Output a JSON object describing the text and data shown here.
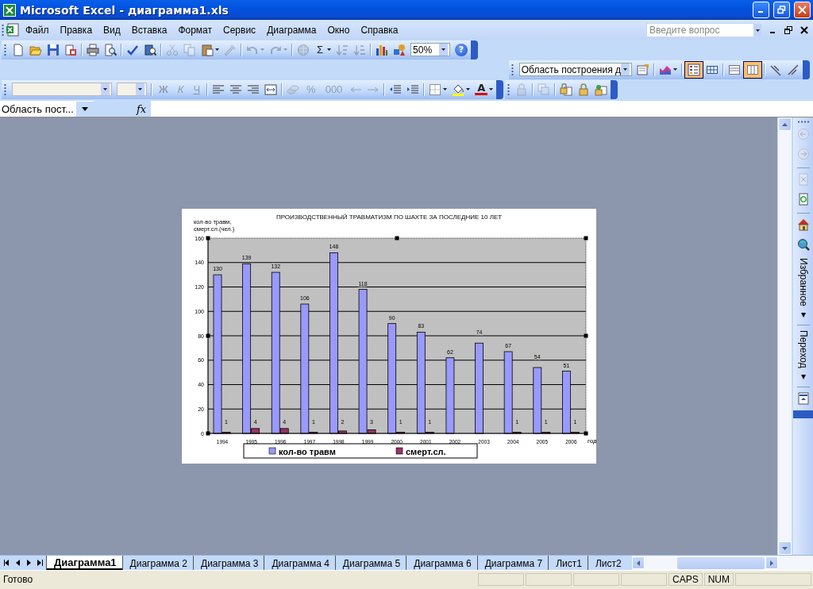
{
  "window": {
    "title": "Microsoft Excel - диаграмма1.xls"
  },
  "menu_bar": {
    "items": [
      "Файл",
      "Правка",
      "Вид",
      "Вставка",
      "Формат",
      "Сервис",
      "Диаграмма",
      "Окно",
      "Справка"
    ],
    "help_search": {
      "placeholder": "Введите вопрос"
    }
  },
  "standard_toolbar": {
    "items": [
      {
        "kind": "icon",
        "disabled": false
      },
      {
        "kind": "icon",
        "disabled": false
      },
      {
        "kind": "icon",
        "disabled": false
      },
      {
        "kind": "icon",
        "disabled": false
      },
      {
        "kind": "separator"
      },
      {
        "kind": "icon",
        "disabled": false
      },
      {
        "kind": "icon",
        "disabled": false
      },
      {
        "kind": "separator"
      },
      {
        "kind": "icon",
        "disabled": false
      },
      {
        "kind": "icon",
        "disabled": false
      },
      {
        "kind": "separator"
      },
      {
        "kind": "icon",
        "disabled": true
      },
      {
        "kind": "icon",
        "disabled": true
      },
      {
        "kind": "icon",
        "disabled": false,
        "dropdown": true
      },
      {
        "kind": "icon",
        "disabled": true
      },
      {
        "kind": "separator"
      },
      {
        "kind": "icon",
        "disabled": true,
        "dropdown": true
      },
      {
        "kind": "icon",
        "disabled": true,
        "dropdown": true
      },
      {
        "kind": "separator"
      },
      {
        "kind": "icon",
        "disabled": true
      },
      {
        "kind": "text",
        "label": "Σ",
        "disabled": false,
        "dropdown": true
      },
      {
        "kind": "icon",
        "disabled": true
      },
      {
        "kind": "icon",
        "disabled": true
      },
      {
        "kind": "separator"
      },
      {
        "kind": "icon",
        "disabled": false
      },
      {
        "kind": "icon",
        "disabled": false
      },
      {
        "kind": "field",
        "value": "50%"
      },
      {
        "kind": "help",
        "label": "?"
      }
    ]
  },
  "chart_toolbar": {
    "items": [
      {
        "kind": "field",
        "value": "Область построения д"
      },
      {
        "kind": "icon",
        "selected": false
      },
      {
        "kind": "separator"
      },
      {
        "kind": "icon",
        "selected": false,
        "dropdown": true
      },
      {
        "kind": "separator"
      },
      {
        "kind": "icon",
        "selected": true
      },
      {
        "kind": "icon",
        "selected": false
      },
      {
        "kind": "separator"
      },
      {
        "kind": "icon",
        "selected": false
      },
      {
        "kind": "icon",
        "selected": true
      },
      {
        "kind": "separator"
      },
      {
        "kind": "icon",
        "selected": false
      },
      {
        "kind": "icon",
        "selected": false
      }
    ]
  },
  "formatting_toolbar": {
    "items": [
      {
        "kind": "field"
      },
      {
        "kind": "field"
      },
      {
        "kind": "separator"
      },
      {
        "kind": "text",
        "label": "Ж",
        "disabled": true
      },
      {
        "kind": "text",
        "label": "К",
        "disabled": true
      },
      {
        "kind": "text",
        "label": "Ч",
        "disabled": true
      },
      {
        "kind": "separator"
      },
      {
        "kind": "icon",
        "disabled": false
      },
      {
        "kind": "icon",
        "disabled": false
      },
      {
        "kind": "icon",
        "disabled": false
      },
      {
        "kind": "icon",
        "disabled": false
      },
      {
        "kind": "separator"
      },
      {
        "kind": "icon",
        "disabled": true
      },
      {
        "kind": "text",
        "label": "%",
        "disabled": true
      },
      {
        "kind": "text",
        "label": "000",
        "disabled": true
      },
      {
        "kind": "icon",
        "disabled": true
      },
      {
        "kind": "icon",
        "disabled": true
      },
      {
        "kind": "separator"
      },
      {
        "kind": "icon",
        "disabled": false
      },
      {
        "kind": "icon",
        "disabled": false
      },
      {
        "kind": "separator"
      },
      {
        "kind": "icon",
        "disabled": false,
        "dropdown": true
      },
      {
        "kind": "icon",
        "disabled": false,
        "dropdown": true
      },
      {
        "kind": "font_color",
        "label": "A",
        "disabled": false,
        "dropdown": true
      }
    ]
  },
  "protection_toolbar": {
    "items": [
      {
        "kind": "icon",
        "disabled": true
      },
      {
        "kind": "separator"
      },
      {
        "kind": "icon",
        "disabled": true
      },
      {
        "kind": "separator"
      },
      {
        "kind": "icon",
        "disabled": false
      },
      {
        "kind": "icon",
        "disabled": false
      },
      {
        "kind": "icon",
        "disabled": false
      }
    ]
  },
  "formula_bar": {
    "name_box": "Область пост...",
    "function_label": "fx"
  },
  "chart_data": {
    "type": "bar",
    "title": "ПРОИЗВОДСТВЕННЫЙ ТРАВМАТИЗМ ПО ШАХТЕ ЗА ПОСЛЕДНИЕ 10 ЛЕТ",
    "xlabel": "год",
    "ylabel": "кол-во травм, смерт.сл.(чел.)",
    "categories": [
      "1994",
      "1995",
      "1996",
      "1997",
      "1998",
      "1999",
      "2000",
      "2001",
      "2002",
      "2003",
      "2004",
      "2005",
      "2006"
    ],
    "series": [
      {
        "name": "кол-во травм",
        "color": "#9999ff",
        "values": [
          130,
          139,
          132,
          106,
          148,
          118,
          90,
          83,
          62,
          74,
          67,
          54,
          51
        ]
      },
      {
        "name": "смерт.сл.",
        "color": "#993366",
        "values": [
          1,
          4,
          4,
          1,
          2,
          3,
          1,
          1,
          null,
          null,
          1,
          1,
          1
        ]
      }
    ],
    "grid": true,
    "legend": true,
    "ylim": [
      0,
      160
    ],
    "yticks": [
      0,
      20,
      40,
      60,
      80,
      100,
      120,
      140,
      160
    ],
    "data_labels": true
  },
  "side_panel": {
    "items": [
      {
        "kind": "icon",
        "disabled": true
      },
      {
        "kind": "icon",
        "disabled": true
      },
      {
        "kind": "separator"
      },
      {
        "kind": "icon",
        "disabled": true
      },
      {
        "kind": "icon",
        "disabled": false
      },
      {
        "kind": "separator"
      },
      {
        "kind": "icon",
        "disabled": false
      },
      {
        "kind": "icon",
        "disabled": false
      },
      {
        "kind": "text",
        "label": "Избранное ▾"
      },
      {
        "kind": "separator"
      },
      {
        "kind": "text",
        "label": "Переход ▾"
      },
      {
        "kind": "separator"
      },
      {
        "kind": "icon",
        "disabled": false
      }
    ]
  },
  "sheet_tabs": [
    {
      "label": "Диаграмма1",
      "selected": true
    },
    {
      "label": "Диаграмма 2",
      "selected": false
    },
    {
      "label": "Диаграмма 3",
      "selected": false
    },
    {
      "label": "Диаграмма 4",
      "selected": false
    },
    {
      "label": "Диаграмма 5",
      "selected": false
    },
    {
      "label": "Диаграмма 6",
      "selected": false
    },
    {
      "label": "Диаграмма 7",
      "selected": false
    },
    {
      "label": "Лист1",
      "selected": false
    },
    {
      "label": "Лист2",
      "selected": false
    }
  ],
  "status_bar": {
    "message": "Готово",
    "indicators": [
      "CAPS",
      "NUM"
    ]
  }
}
